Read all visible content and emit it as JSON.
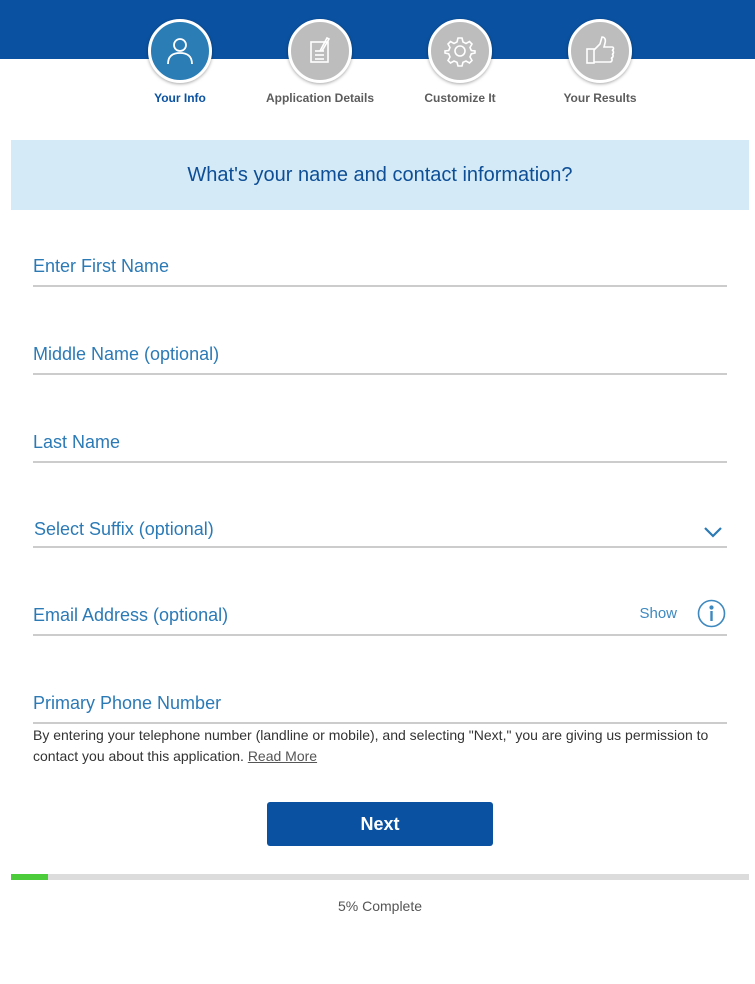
{
  "steps": [
    {
      "label": "Your Info",
      "icon": "person-icon",
      "active": true
    },
    {
      "label": "Application Details",
      "icon": "document-edit-icon",
      "active": false
    },
    {
      "label": "Customize It",
      "icon": "gear-icon",
      "active": false
    },
    {
      "label": "Your Results",
      "icon": "thumbs-up-icon",
      "active": false
    }
  ],
  "question": "What's your name and contact information?",
  "form": {
    "first_name": {
      "placeholder": "Enter First Name",
      "value": ""
    },
    "middle_name": {
      "placeholder": "Middle Name (optional)",
      "value": ""
    },
    "last_name": {
      "placeholder": "Last Name",
      "value": ""
    },
    "suffix": {
      "selected": "Select Suffix (optional)"
    },
    "email": {
      "placeholder": "Email Address (optional)",
      "value": "",
      "show_label": "Show"
    },
    "phone": {
      "placeholder": "Primary Phone Number",
      "value": ""
    }
  },
  "disclaimer": {
    "text": "By entering your telephone number (landline or mobile), and selecting \"Next,\" you are giving us permission to contact you about this application. ",
    "link": "Read More"
  },
  "next_label": "Next",
  "progress": {
    "percent": 5,
    "label": "5% Complete"
  },
  "colors": {
    "brand": "#0a52a1",
    "active_step": "#2a7db5",
    "inactive_step": "#bdbdbd",
    "progress": "#4ccc3a",
    "banner": "#d4ebf7"
  }
}
